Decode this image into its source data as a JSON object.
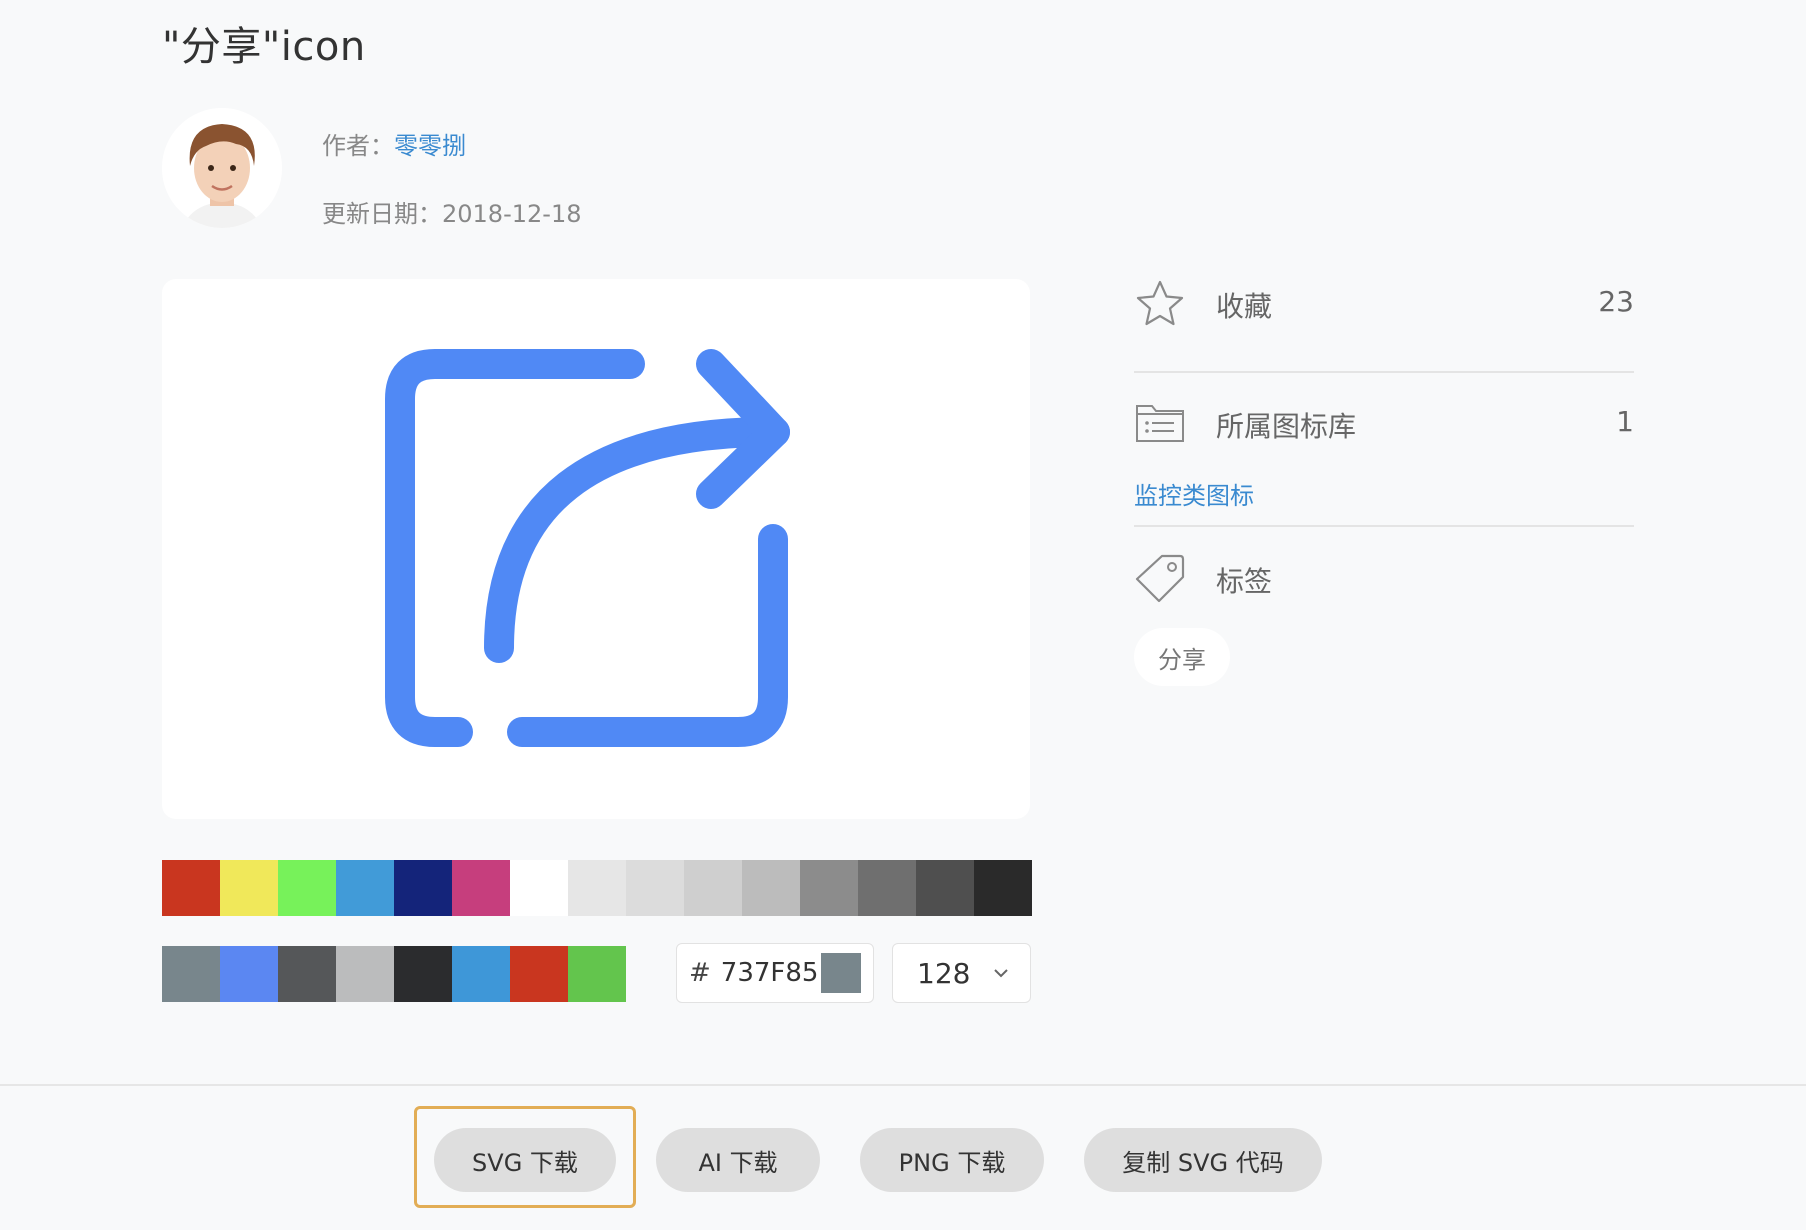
{
  "page_title": "\"分享\"icon",
  "author": {
    "label": "作者：",
    "name": "零零捌"
  },
  "updated": {
    "label": "更新日期：",
    "date": "2018-12-18"
  },
  "preview_icon": {
    "name": "share-icon",
    "color": "#5089f5"
  },
  "palette_row1": [
    "#c9361f",
    "#f0e85a",
    "#77f25a",
    "#419bd8",
    "#14247a",
    "#c63e7d",
    "#ffffff",
    "#e6e6e6",
    "#dcdcdc",
    "#cfcfcf",
    "#bcbcbc",
    "#8c8c8c",
    "#6f6f6f",
    "#4f4f4f",
    "#2a2a2a"
  ],
  "palette_row2": [
    "#78868c",
    "#5b87f2",
    "#555759",
    "#bbbcbd",
    "#2b2c2e",
    "#3e97d8",
    "#c9361f",
    "#63c54d"
  ],
  "color_input": {
    "hash": "#",
    "value": "737F85",
    "chip_color": "#78868c"
  },
  "size_select": {
    "value": "128"
  },
  "sidebar": {
    "favorite": {
      "label": "收藏",
      "count": "23"
    },
    "library": {
      "label": "所属图标库",
      "count": "1",
      "link": "监控类图标"
    },
    "tags": {
      "label": "标签",
      "items": [
        "分享"
      ]
    }
  },
  "actions": {
    "svg": "SVG 下载",
    "ai": "AI 下载",
    "png": "PNG 下载",
    "copy_svg": "复制 SVG 代码"
  }
}
